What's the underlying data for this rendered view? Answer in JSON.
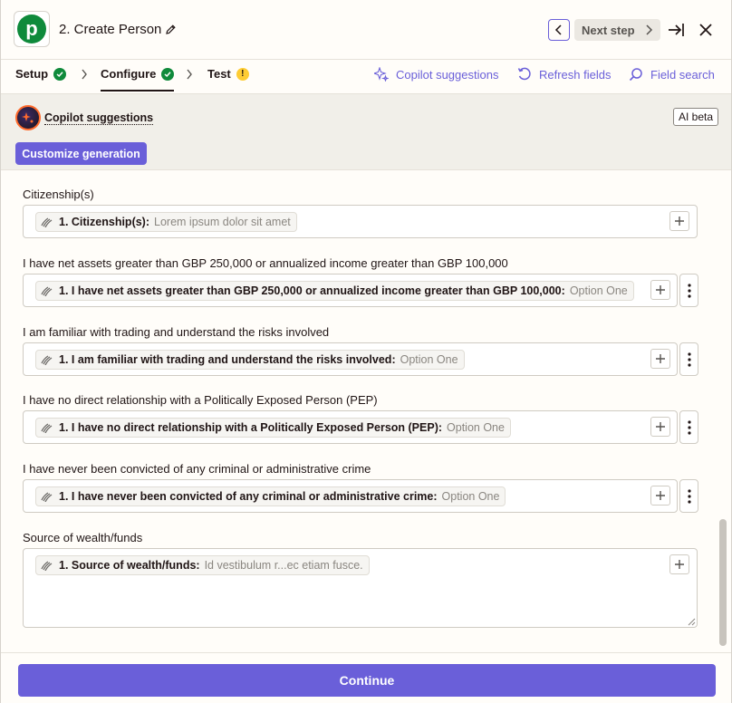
{
  "header": {
    "step_title": "2. Create Person",
    "next_step_label": "Next step",
    "app_logo_letter": "p"
  },
  "tabs": [
    {
      "label": "Setup",
      "status": "complete"
    },
    {
      "label": "Configure",
      "status": "complete",
      "active": true
    },
    {
      "label": "Test",
      "status": "warning"
    }
  ],
  "tools": {
    "copilot": "Copilot suggestions",
    "refresh": "Refresh fields",
    "search": "Field search"
  },
  "copilot_panel": {
    "label": "Copilot suggestions",
    "badge": "AI beta",
    "customize_button": "Customize generation"
  },
  "fields": [
    {
      "label": "Citizenship(s)",
      "pill_name": "1. Citizenship(s):",
      "pill_value": "Lorem ipsum dolor sit amet"
    },
    {
      "label": "I have net assets greater than GBP 250,000 or annualized income greater than GBP 100,000",
      "pill_name": "1. I have net assets greater than GBP 250,000 or annualized income greater than GBP 100,000:",
      "pill_value": "Option One"
    },
    {
      "label": "I am familiar with trading and understand the risks involved",
      "pill_name": "1. I am familiar with trading and understand the risks involved:",
      "pill_value": "Option One"
    },
    {
      "label": "I have no direct relationship with a Politically Exposed Person (PEP)",
      "pill_name": "1. I have no direct relationship with a Politically Exposed Person (PEP):",
      "pill_value": "Option One"
    },
    {
      "label": "I have never been convicted of any criminal or administrative crime",
      "pill_name": "1. I have never been convicted of any criminal or administrative crime:",
      "pill_value": "Option One"
    },
    {
      "label": "Source of wealth/funds",
      "pill_name": "1. Source of wealth/funds:",
      "pill_value": "Id vestibulum r...ec etiam fusce."
    }
  ],
  "footer": {
    "continue_label": "Continue"
  },
  "colors": {
    "accent": "#6a5fd9",
    "success": "#0f8a3b",
    "warning": "#fecc33"
  }
}
